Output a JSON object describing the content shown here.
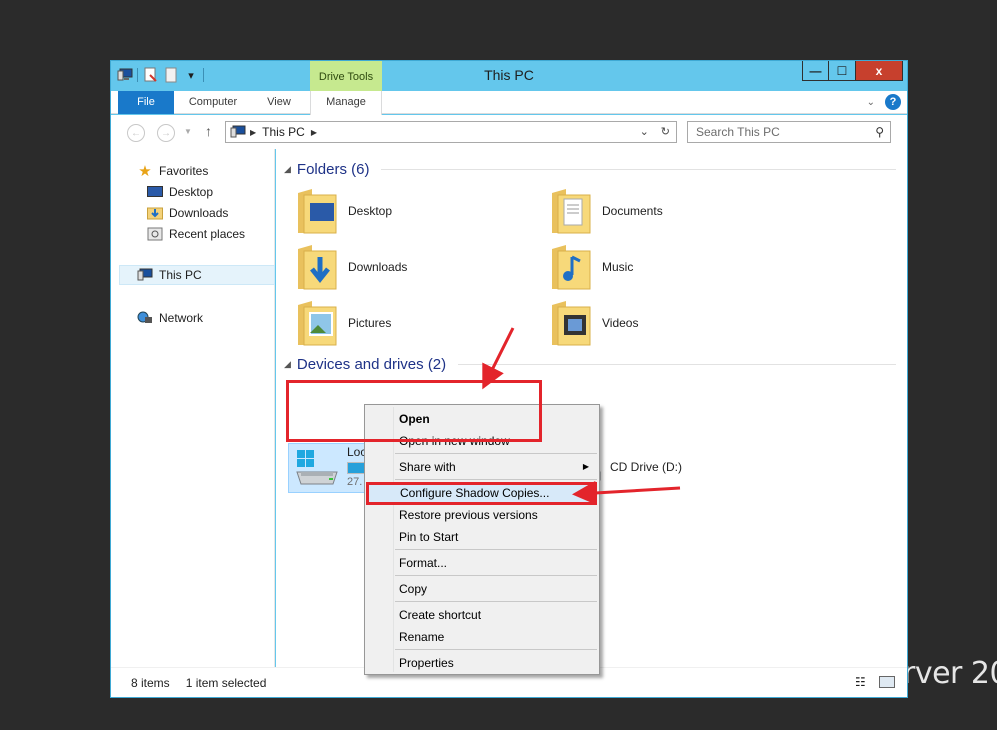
{
  "desktop": {
    "bg_text": "rver 20"
  },
  "window": {
    "title": "This PC",
    "context_tab": "Drive Tools",
    "buttons": {
      "minimize": "—",
      "maximize": "☐",
      "close": "x"
    }
  },
  "ribbon": {
    "tabs": [
      "File",
      "Computer",
      "View",
      "Manage"
    ],
    "help": "?"
  },
  "nav": {
    "breadcrumb": "This PC",
    "search_placeholder": "Search This PC"
  },
  "sidebar": {
    "favorites": "Favorites",
    "desktop": "Desktop",
    "downloads": "Downloads",
    "recent": "Recent places",
    "thispc": "This PC",
    "network": "Network"
  },
  "folders_group": {
    "title": "Folders (6)",
    "items": [
      "Desktop",
      "Documents",
      "Downloads",
      "Music",
      "Pictures",
      "Videos"
    ]
  },
  "devices_group": {
    "title": "Devices and drives (2)",
    "drive_c": {
      "name": "Local Disk (C:)",
      "free_text": "27.",
      "used_fraction": 0.3
    },
    "drive_d": {
      "name": "CD Drive (D:)"
    }
  },
  "context_menu": {
    "items": [
      "Open",
      "Open in new window",
      "Share with",
      "Configure Shadow Copies...",
      "Restore previous versions",
      "Pin to Start",
      "Format...",
      "Copy",
      "Create shortcut",
      "Rename",
      "Properties"
    ]
  },
  "status": {
    "count": "8 items",
    "selection": "1 item selected"
  },
  "colors": {
    "accent": "#1979ca",
    "window_frame": "#64c7ec",
    "annotation_red": "#e3242b"
  }
}
